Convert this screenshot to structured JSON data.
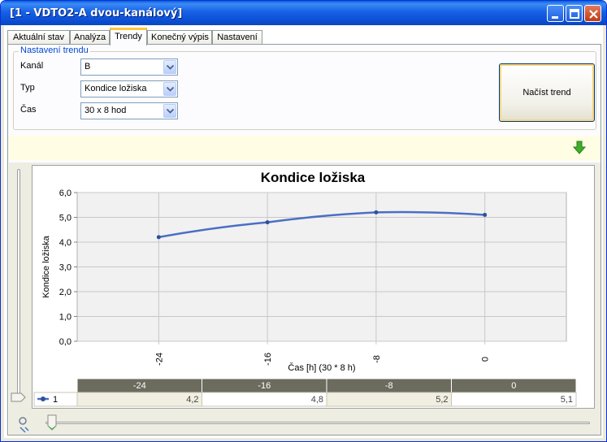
{
  "window": {
    "title": "[1 - VDTO2-A dvou-kanálový]"
  },
  "tabs": [
    {
      "label": "Aktuální stav"
    },
    {
      "label": "Analýza"
    },
    {
      "label": "Trendy"
    },
    {
      "label": "Konečný výpis"
    },
    {
      "label": "Nastavení"
    }
  ],
  "active_tab": "Trendy",
  "settings": {
    "legend": "Nastavení trendu",
    "channel_label": "Kanál",
    "channel_value": "B",
    "type_label": "Typ",
    "type_value": "Kondice ložiska",
    "time_label": "Čas",
    "time_value": "30 x 8 hod",
    "load_button": "Načíst trend"
  },
  "colors": {
    "series": "#4a6fc4",
    "header_cell": "#6b6b5e",
    "accent": "#0046d5"
  },
  "chart_data": {
    "type": "line",
    "title": "Kondice ložiska",
    "xlabel": "Čas [h] (30 * 8 h)",
    "ylabel": "Kondice ložiska",
    "categories": [
      "-24",
      "-16",
      "-8",
      "0"
    ],
    "yticks": [
      "6,0",
      "5,0",
      "4,0",
      "3,0",
      "2,0",
      "1,0",
      "0,0"
    ],
    "ylim": [
      0,
      6
    ],
    "series": [
      {
        "name": "1",
        "values": [
          4.2,
          4.8,
          5.2,
          5.1
        ]
      }
    ],
    "table_values": [
      "4,2",
      "4,8",
      "5,2",
      "5,1"
    ],
    "grid": true
  }
}
